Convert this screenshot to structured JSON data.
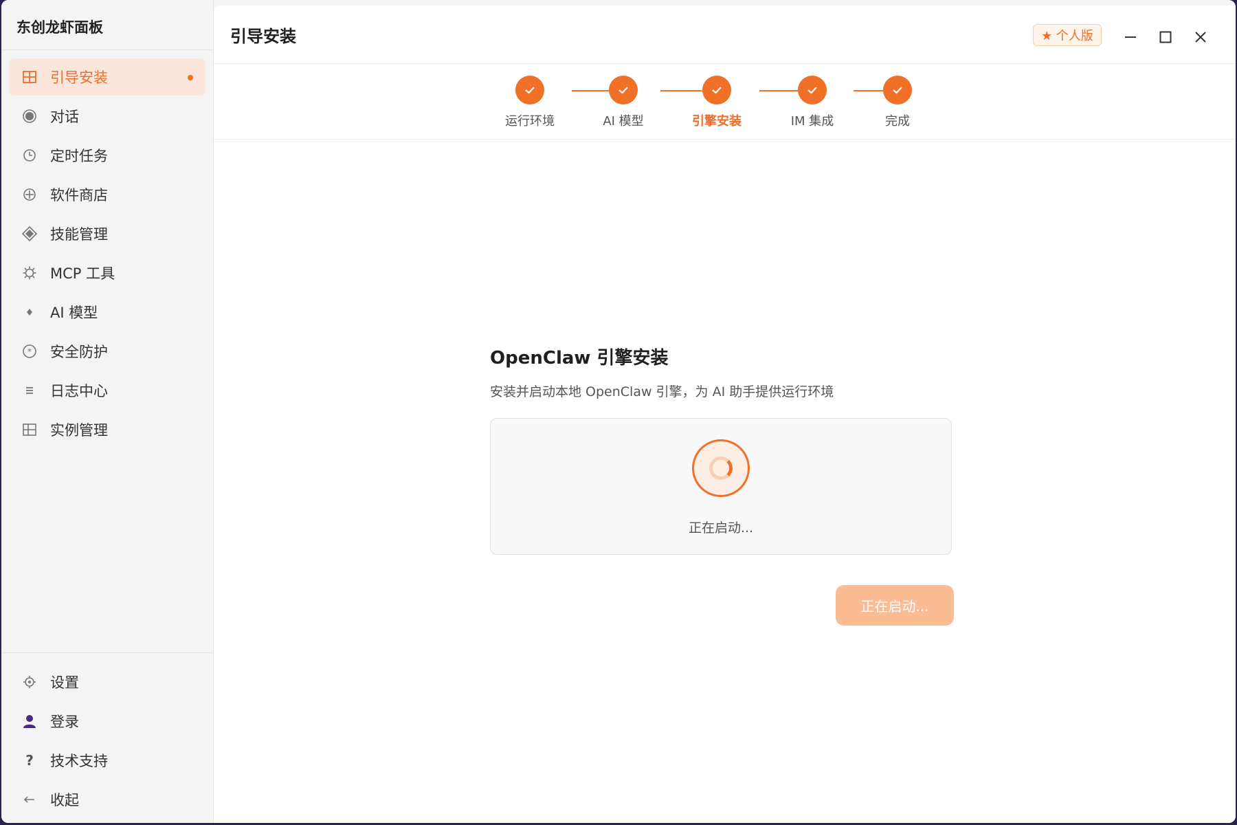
{
  "app": {
    "title": "东创龙虾面板"
  },
  "sidebar": {
    "items": [
      {
        "label": "引导安装",
        "icon": "grid-icon",
        "active": true
      },
      {
        "label": "对话",
        "icon": "chat-icon"
      },
      {
        "label": "定时任务",
        "icon": "clock-icon"
      },
      {
        "label": "软件商店",
        "icon": "store-icon"
      },
      {
        "label": "技能管理",
        "icon": "skills-icon"
      },
      {
        "label": "MCP 工具",
        "icon": "tool-icon"
      },
      {
        "label": "AI 模型",
        "icon": "model-icon"
      },
      {
        "label": "安全防护",
        "icon": "shield-icon"
      },
      {
        "label": "日志中心",
        "icon": "list-icon"
      },
      {
        "label": "实例管理",
        "icon": "instance-icon"
      }
    ],
    "bottom": [
      {
        "label": "设置",
        "icon": "gear-icon"
      },
      {
        "label": "登录",
        "icon": "user-icon"
      },
      {
        "label": "技术支持",
        "icon": "help-icon"
      },
      {
        "label": "收起",
        "icon": "collapse-icon"
      }
    ]
  },
  "header": {
    "title": "引导安装",
    "edition_badge": "★ 个人版"
  },
  "stepper": {
    "steps": [
      {
        "label": "运行环境"
      },
      {
        "label": "AI 模型"
      },
      {
        "label": "引擎安装",
        "current": true
      },
      {
        "label": "IM 集成"
      },
      {
        "label": "完成"
      }
    ]
  },
  "install": {
    "title": "OpenClaw 引擎安装",
    "subtitle": "安装并启动本地 OpenClaw 引擎，为 AI 助手提供运行环境",
    "status": "正在启动...",
    "button_label": "正在启动..."
  },
  "colors": {
    "accent": "#f07027",
    "accent_light": "#fbe6dc",
    "button_disabled": "#fbbc94"
  }
}
